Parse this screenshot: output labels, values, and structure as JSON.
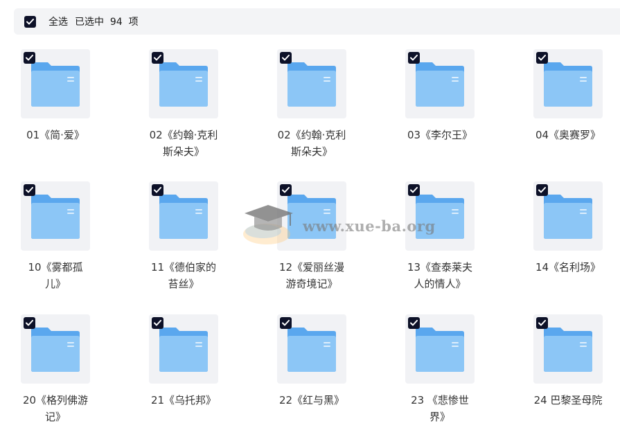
{
  "toolbar": {
    "select_all_label": "全选",
    "selected_text": "已选中  94  项",
    "checked": true
  },
  "items": [
    {
      "label": "01《简·爱》",
      "checked": true
    },
    {
      "label": "02《约翰·克利斯朵夫》",
      "checked": true
    },
    {
      "label": "02《约翰·克利斯朵夫》",
      "checked": true
    },
    {
      "label": "03《李尔王》",
      "checked": true
    },
    {
      "label": "04《奥赛罗》",
      "checked": true
    },
    {
      "label": "10《雾都孤儿》",
      "checked": true
    },
    {
      "label": "11《德伯家的苔丝》",
      "checked": true
    },
    {
      "label": "12《爱丽丝漫游奇境记》",
      "checked": true
    },
    {
      "label": "13《查泰莱夫人的情人》",
      "checked": true
    },
    {
      "label": "14《名利场》",
      "checked": true
    },
    {
      "label": "20《格列佛游记》",
      "checked": true
    },
    {
      "label": "21《乌托邦》",
      "checked": true
    },
    {
      "label": "22《红与黑》",
      "checked": true
    },
    {
      "label": "23 《悲惨世界》",
      "checked": true
    },
    {
      "label": "24 巴黎圣母院",
      "checked": true
    }
  ],
  "watermark": {
    "text": "www.xue-ba.org"
  },
  "colors": {
    "checkbox": "#0d1128",
    "folder_back": "#5aa7ee",
    "folder_front": "#8cc6f6",
    "tile_bg": "#f1f2f5",
    "bar_bg": "#f3f4f6"
  }
}
